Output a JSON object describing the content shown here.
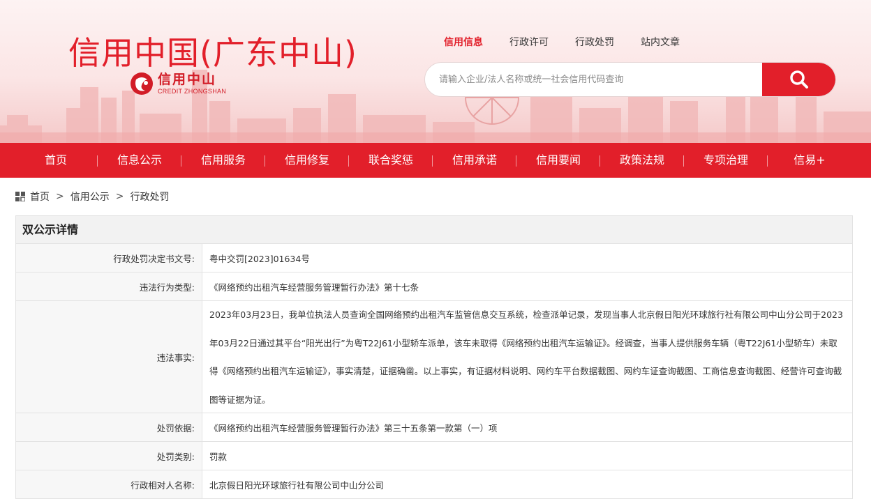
{
  "header": {
    "site_title": "信用中国(广东中山)",
    "logo_cn": "信用中山",
    "logo_en": "CREDIT ZHONGSHAN"
  },
  "top_tabs": [
    {
      "label": "信用信息",
      "active": true
    },
    {
      "label": "行政许可",
      "active": false
    },
    {
      "label": "行政处罚",
      "active": false
    },
    {
      "label": "站内文章",
      "active": false
    }
  ],
  "search": {
    "placeholder": "请输入企业/法人名称或统一社会信用代码查询",
    "button_icon": "search-icon"
  },
  "nav": [
    {
      "label": "首页"
    },
    {
      "label": "信息公示"
    },
    {
      "label": "信用服务"
    },
    {
      "label": "信用修复"
    },
    {
      "label": "联合奖惩"
    },
    {
      "label": "信用承诺"
    },
    {
      "label": "信用要闻"
    },
    {
      "label": "政策法规"
    },
    {
      "label": "专项治理"
    },
    {
      "label": "信易+"
    }
  ],
  "breadcrumb": {
    "icon": "grid-icon",
    "items": [
      "首页",
      "信用公示",
      "行政处罚"
    ],
    "separator": ">"
  },
  "detail": {
    "title": "双公示详情",
    "rows": [
      {
        "label": "行政处罚决定书文号:",
        "value": "粤中交罚[2023]01634号"
      },
      {
        "label": "违法行为类型:",
        "value": "《网络预约出租汽车经营服务管理暂行办法》第十七条"
      },
      {
        "label": "违法事实:",
        "value": "2023年03月23日，我单位执法人员查询全国网络预约出租汽车监管信息交互系统，检查派单记录，发现当事人北京假日阳光环球旅行社有限公司中山分公司于2023年03月22日通过其平台“阳光出行”为粤T22J61小型轿车派单，该车未取得《网络预约出租汽车运输证》。经调查，当事人提供服务车辆（粤T22J61小型轿车）未取得《网络预约出租汽车运输证》，事实清楚，证据确凿。以上事实，有证据材料说明、网约车平台数据截图、网约车证查询截图、工商信息查询截图、经营许可查询截图等证据为证。"
      },
      {
        "label": "处罚依据:",
        "value": "《网络预约出租汽车经营服务管理暂行办法》第三十五条第一款第（一）项"
      },
      {
        "label": "处罚类别:",
        "value": "罚款"
      },
      {
        "label": "行政相对人名称:",
        "value": "北京假日阳光环球旅行社有限公司中山分公司"
      }
    ]
  },
  "colors": {
    "brand_red": "#e21f2a",
    "label_bg": "#f7f7f7",
    "border": "#e3e3e3"
  }
}
